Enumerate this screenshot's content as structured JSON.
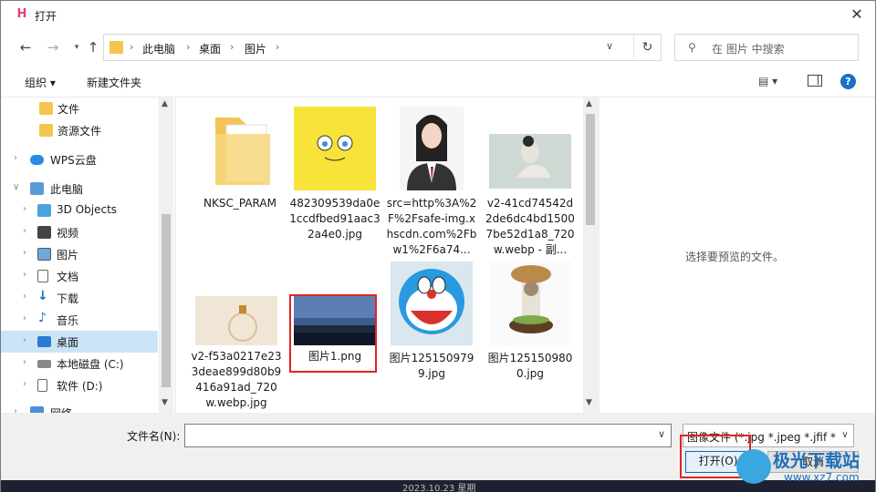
{
  "titlebar": {
    "title": "打开",
    "app_icon": "H",
    "close": "✕"
  },
  "nav": {
    "back": "←",
    "forward": "→",
    "up": "↑",
    "breadcrumbs": [
      "此电脑",
      "桌面",
      "图片"
    ],
    "separator": "›",
    "refresh": "↻",
    "search_placeholder": "在 图片 中搜索"
  },
  "toolbar": {
    "organize": "组织 ▾",
    "new_folder": "新建文件夹",
    "view": "▤ ▾",
    "help": "?"
  },
  "tree": [
    {
      "label": "文件",
      "icon": "folder-icon",
      "level": 2
    },
    {
      "label": "资源文件",
      "icon": "folder-icon",
      "level": 2
    },
    {
      "label": "WPS云盘",
      "icon": "cloud-icon",
      "level": 1
    },
    {
      "label": "此电脑",
      "icon": "computer-icon",
      "level": 1
    },
    {
      "label": "3D Objects",
      "icon": "cube-icon",
      "level": 2
    },
    {
      "label": "视频",
      "icon": "video-icon",
      "level": 2
    },
    {
      "label": "图片",
      "icon": "pictures-icon",
      "level": 2
    },
    {
      "label": "文档",
      "icon": "document-icon",
      "level": 2
    },
    {
      "label": "下载",
      "icon": "download-icon",
      "level": 2
    },
    {
      "label": "音乐",
      "icon": "music-icon",
      "level": 2
    },
    {
      "label": "桌面",
      "icon": "desktop-icon",
      "level": 2
    },
    {
      "label": "本地磁盘 (C:)",
      "icon": "drive-icon",
      "level": 2
    },
    {
      "label": "软件 (D:)",
      "icon": "drive-icon",
      "level": 2
    },
    {
      "label": "网络",
      "icon": "network-icon",
      "level": 1
    }
  ],
  "files": [
    {
      "name": "NKSC_PARAM"
    },
    {
      "name": "482309539da0e1ccdfbed91aac32a4e0.jpg"
    },
    {
      "name": "src=http%3A%2F%2Fsafe-img.xhscdn.com%2Fbw1%2F6a74..."
    },
    {
      "name": "v2-41cd74542d2de6dc4bd15007be52d1a8_720w.webp - 副..."
    },
    {
      "name": "v2-f53a0217e233deae899d80b9416a91ad_720w.webp.jpg"
    },
    {
      "name": "图片1.png"
    },
    {
      "name": "图片1251509799.jpg"
    },
    {
      "name": "图片1251509800.jpg"
    }
  ],
  "preview": {
    "message": "选择要预览的文件。"
  },
  "bottom": {
    "filename_label": "文件名(N):",
    "filename_value": "",
    "filter": "图像文件 (*.jpg *.jpeg *.jfif *.b",
    "open": "打开(O)",
    "cancel": "取消"
  },
  "taskbar": {
    "text": "2023.10.23 星期"
  },
  "watermark": {
    "text": "极光下载站",
    "url": "www.xz7.com"
  },
  "colors": {
    "accent": "#0a64c8",
    "highlight": "#e02424",
    "selected": "#cce4f7"
  }
}
